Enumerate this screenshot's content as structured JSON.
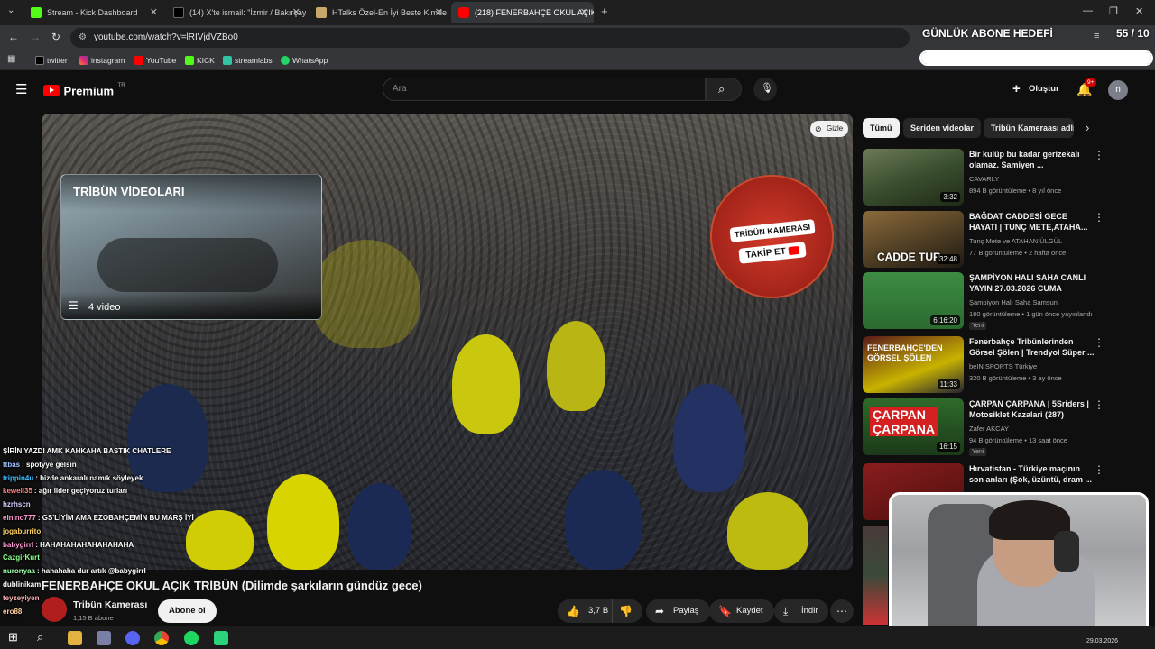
{
  "browser": {
    "tabs": [
      {
        "label": "Stream - Kick Dashboard",
        "color": "#53fc18"
      },
      {
        "label": "(14) X'te ismail: \"İzmir / Bakırçay",
        "color": "#000000"
      },
      {
        "label": "HTalks Özel-En İyi Beste Kimde",
        "color": "#c8a96b"
      },
      {
        "label": "(218) FENERBAHÇE OKUL AÇIK",
        "color": "#ff0000"
      }
    ],
    "url": "youtube.com/watch?v=lRIVjdVZBo0",
    "bookmarks": [
      "twitter",
      "instagram",
      "YouTube",
      "KICK",
      "streamlabs",
      "WhatsApp"
    ]
  },
  "overlay": {
    "goal_label": "GÜNLÜK ABONE HEDEFİ",
    "goal_count": "55 / 10",
    "goal_progress": 1.0
  },
  "youtube": {
    "logo": "Premium",
    "logo_sup": "TR",
    "search_placeholder": "Ara",
    "create_label": "Oluştur",
    "notif_badge": "9+",
    "avatar_letter": "n",
    "hide_label": "Gizle",
    "playlist_title": "TRİBÜN VİDEOLARI",
    "playlist_count": "4 video",
    "sticker_line1": "TRİBÜN KAMERASI",
    "sticker_line2": "TAKİP ET",
    "video_title": "FENERBAHÇE OKUL AÇIK TRİBÜN (Dilimde şarkıların gündüz gece)",
    "channel_name": "Tribün Kamerası",
    "channel_subs": "1,15 B abone",
    "subscribe_label": "Abone ol",
    "likes": "3,7 B",
    "share_label": "Paylaş",
    "save_label": "Kaydet",
    "download_label": "İndir",
    "chips": [
      "Tümü",
      "Seriden videolar",
      "Tribün Kameraası adlı"
    ],
    "recommendations": [
      {
        "title": "Bir kulüp bu kadar gerizekalı olamaz. Samiyen ...",
        "channel": "CAVARLY",
        "meta": "894 B görüntüleme • 8 yıl önce",
        "duration": "3:32",
        "new": ""
      },
      {
        "title": "BAĞDAT CADDESİ GECE HAYATI | TUNÇ METE,ATAHA...",
        "channel": "Tunç Mete ve ATAHAN ÜLGÜL",
        "meta": "77 B görüntüleme • 2 hafta önce",
        "duration": "32:48",
        "new": ""
      },
      {
        "title": "ŞAMPİYON HALI SAHA CANLI YAYIN 27.03.2026 CUMA",
        "channel": "Şampiyon Halı Saha Samsun",
        "meta": "180 görüntüleme • 1 gün önce yayınlandı",
        "duration": "6:16:20",
        "new": "Yeni"
      },
      {
        "title": "Fenerbahçe Tribünlerinden Görsel Şölen | Trendyol Süper ...",
        "channel": "beIN SPORTS Türkiye",
        "meta": "320 B görüntüleme • 3 ay önce",
        "duration": "11:33",
        "new": ""
      },
      {
        "title": "ÇARPAN ÇARPANA | 5Sriders | Motosiklet Kazalari (287)",
        "channel": "Zafer AKCAY",
        "meta": "94 B görüntüleme • 13 saat önce",
        "duration": "16:15",
        "new": "Yeni"
      },
      {
        "title": "Hırvatistan - Türkiye maçının son anları (Şok, üzüntü, dram ...",
        "channel": "",
        "meta": "",
        "duration": "",
        "new": ""
      }
    ]
  },
  "chat": [
    {
      "user": "ŞİRİN YAZDI AMK KAHKAHA BASTIK CHATLERE",
      "msg": "",
      "color": "#ffffff"
    },
    {
      "user": "ttbas",
      "msg": "spotyye gelsin",
      "color": "#a0c4ff"
    },
    {
      "user": "trippin4u",
      "msg": "bizde ankaralı namık söyleyek",
      "color": "#3ec1ff"
    },
    {
      "user": "kewell35",
      "msg": "ağır lider geçiyoruz turları",
      "color": "#ff8a8a"
    },
    {
      "user": "hzrhscn",
      "msg": "",
      "color": "#d0d0ff"
    },
    {
      "user": "elnino777",
      "msg": "GS'LİYİM AMA EZOBAHÇEMİN BU MARŞ İYİ",
      "color": "#ff9bd2"
    },
    {
      "user": "jogaburrito",
      "msg": "",
      "color": "#ffd166"
    },
    {
      "user": "babygirrl",
      "msg": "HAHAHAHAHAHAHAHAHA",
      "color": "#ff9bd2"
    },
    {
      "user": "CazgirKurt",
      "msg": "",
      "color": "#8cff8c"
    },
    {
      "user": "nuronyaa",
      "msg": "hahahaha dur artık @babygirrl",
      "color": "#a0ffb0"
    },
    {
      "user": "dublinikam",
      "msg": "",
      "color": "#ffffff"
    },
    {
      "user": "teyzeyiyen",
      "msg": "",
      "color": "#ffb3b3"
    },
    {
      "user": "ero88",
      "msg": "",
      "color": "#ffd0a0"
    }
  ],
  "taskbar": {
    "date": "29.03.2026"
  },
  "colors": {
    "accent_red": "#ff0000",
    "kick_green": "#53fc18",
    "yellow": "#e6e000",
    "navy": "#1b2a55"
  }
}
